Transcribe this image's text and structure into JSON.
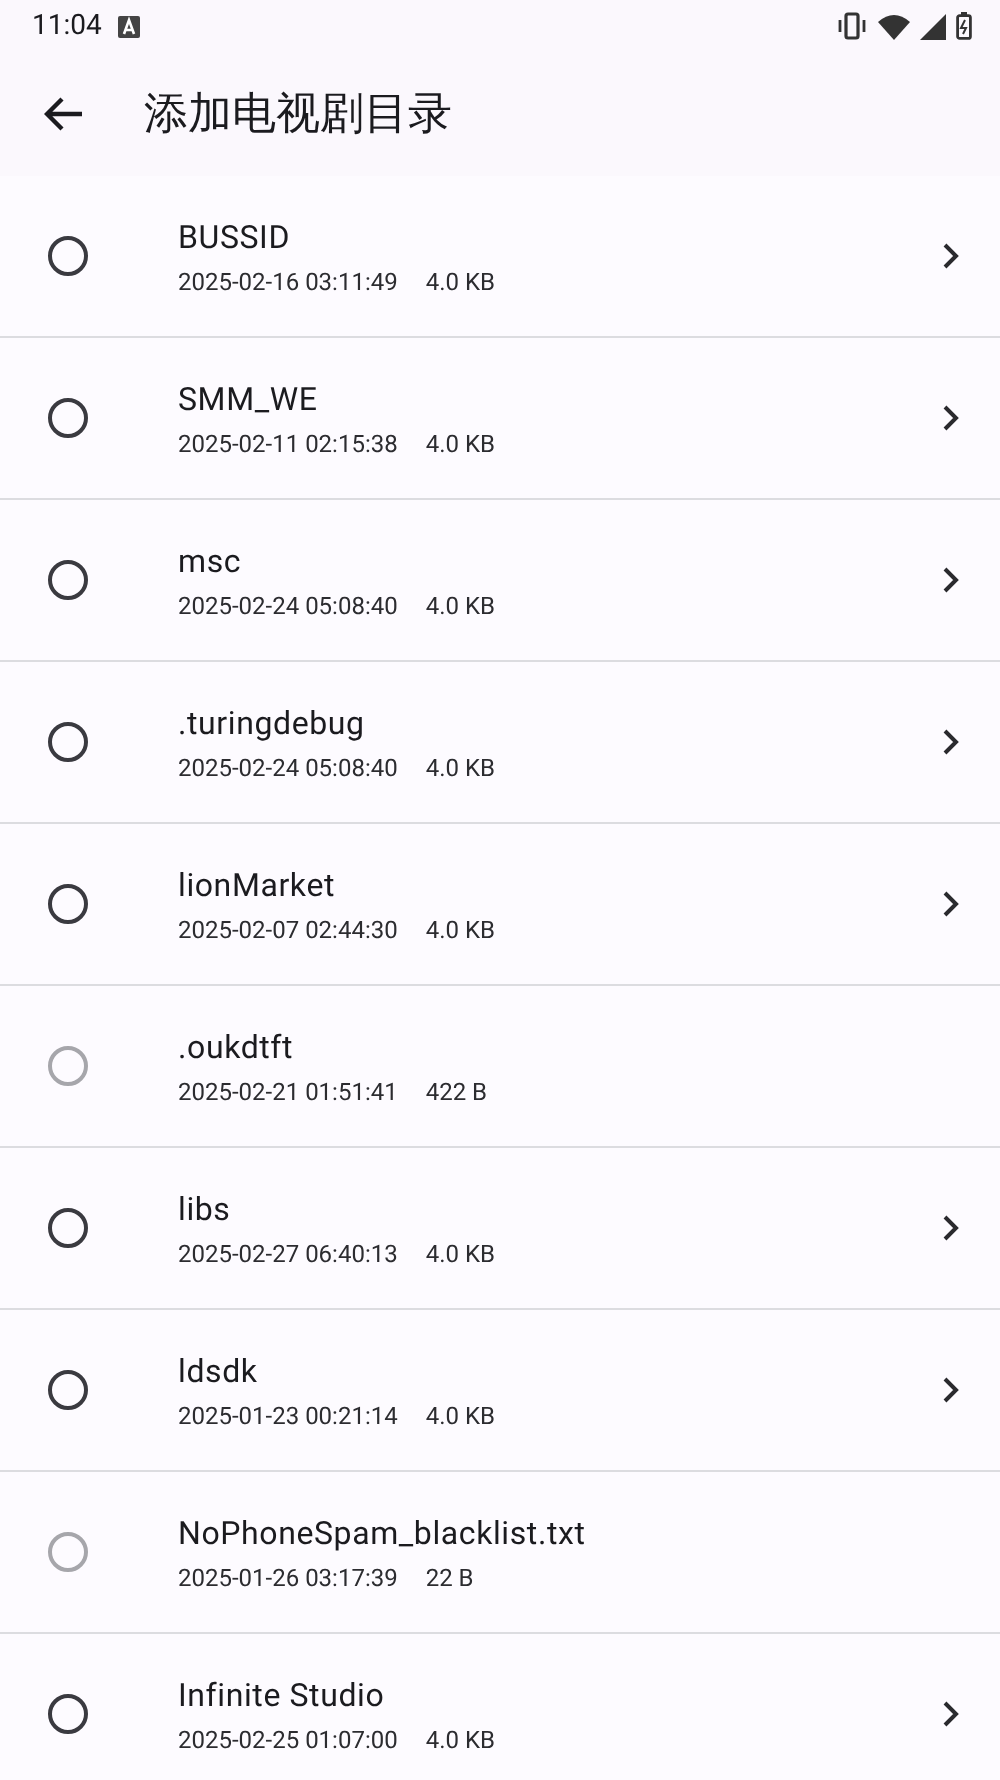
{
  "status_bar": {
    "time": "11:04"
  },
  "app_bar": {
    "title": "添加电视剧目录"
  },
  "items": [
    {
      "kind": "folder",
      "name": "BUSSID",
      "date": "2025-02-16 03:11:49",
      "size": "4.0 KB",
      "selected": false
    },
    {
      "kind": "folder",
      "name": "SMM_WE",
      "date": "2025-02-11 02:15:38",
      "size": "4.0 KB",
      "selected": false
    },
    {
      "kind": "folder",
      "name": "msc",
      "date": "2025-02-24 05:08:40",
      "size": "4.0 KB",
      "selected": false
    },
    {
      "kind": "folder",
      "name": ".turingdebug",
      "date": "2025-02-24 05:08:40",
      "size": "4.0 KB",
      "selected": false
    },
    {
      "kind": "folder",
      "name": "lionMarket",
      "date": "2025-02-07 02:44:30",
      "size": "4.0 KB",
      "selected": false
    },
    {
      "kind": "file",
      "name": ".oukdtft",
      "date": "2025-02-21 01:51:41",
      "size": "422 B",
      "selected": false
    },
    {
      "kind": "folder",
      "name": "libs",
      "date": "2025-02-27 06:40:13",
      "size": "4.0 KB",
      "selected": false
    },
    {
      "kind": "folder",
      "name": "ldsdk",
      "date": "2025-01-23 00:21:14",
      "size": "4.0 KB",
      "selected": false
    },
    {
      "kind": "file",
      "name": "NoPhoneSpam_blacklist.txt",
      "date": "2025-01-26 03:17:39",
      "size": "22 B",
      "selected": false
    },
    {
      "kind": "folder",
      "name": "Infinite Studio",
      "date": "2025-02-25 01:07:00",
      "size": "4.0 KB",
      "selected": false
    }
  ]
}
